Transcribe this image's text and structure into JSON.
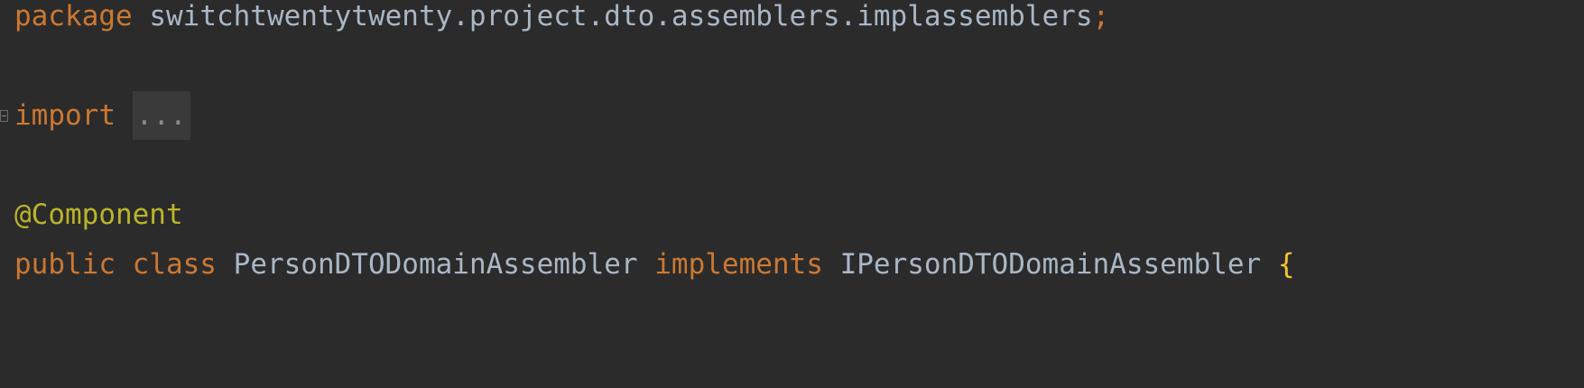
{
  "code": {
    "line1": {
      "keyword": "package",
      "name": "switchtwentytwenty.project.dto.assemblers.implassemblers",
      "semicolon": ";"
    },
    "line3": {
      "keyword": "import",
      "folded": "..."
    },
    "line5": {
      "annotation": "@Component"
    },
    "line6": {
      "modifier": "public",
      "keyword_class": "class",
      "class_name": "PersonDTODomainAssembler",
      "keyword_implements": "implements",
      "interface_name": "IPersonDTODomainAssembler",
      "brace": "{"
    }
  },
  "colors": {
    "background": "#2b2b2b",
    "keyword": "#cc7832",
    "identifier": "#a9b7c6",
    "annotation": "#bbb529",
    "brace": "#f4c430"
  },
  "icons": {
    "fold": "fold-collapse-icon"
  }
}
